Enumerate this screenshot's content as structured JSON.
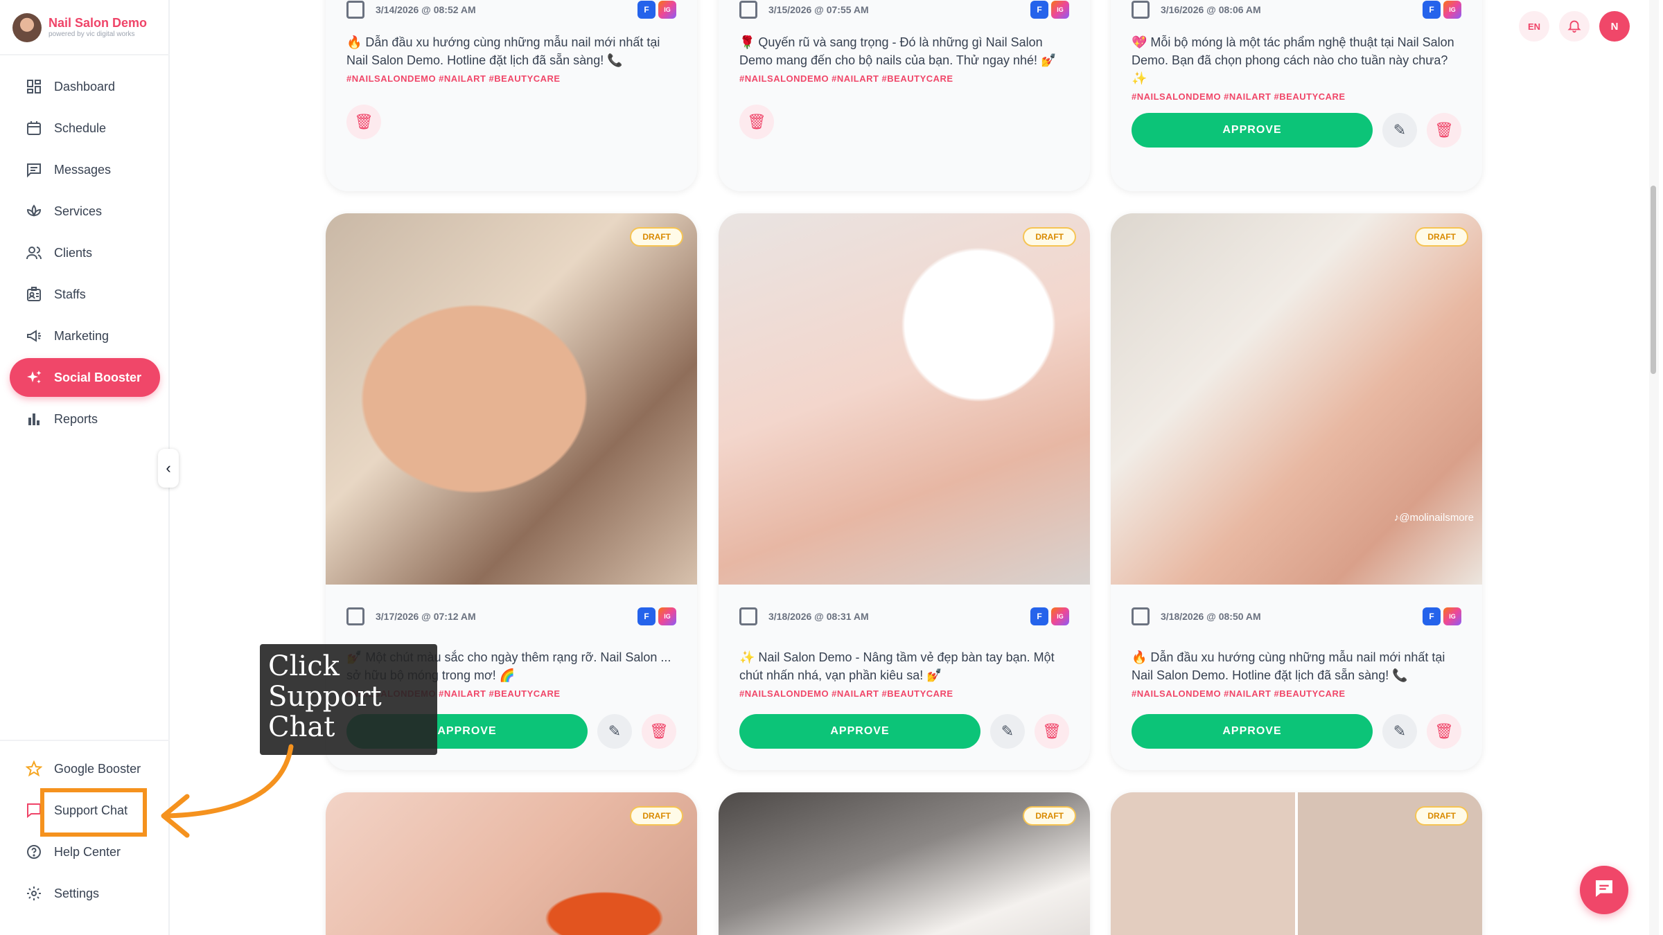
{
  "brand": {
    "name": "Nail Salon Demo",
    "subtitle": "powered by vic digital works"
  },
  "sidebar": {
    "items": [
      {
        "label": "Dashboard",
        "icon": "dashboard-icon"
      },
      {
        "label": "Schedule",
        "icon": "calendar-icon"
      },
      {
        "label": "Messages",
        "icon": "message-icon"
      },
      {
        "label": "Services",
        "icon": "lotus-icon"
      },
      {
        "label": "Clients",
        "icon": "users-icon"
      },
      {
        "label": "Staffs",
        "icon": "id-badge-icon"
      },
      {
        "label": "Marketing",
        "icon": "megaphone-icon"
      },
      {
        "label": "Social Booster",
        "icon": "sparkle-icon",
        "active": true
      },
      {
        "label": "Reports",
        "icon": "bar-chart-icon"
      }
    ],
    "bottom": [
      {
        "label": "Google Booster",
        "icon": "star-icon"
      },
      {
        "label": "Support Chat",
        "icon": "chat-icon"
      },
      {
        "label": "Help Center",
        "icon": "help-icon"
      },
      {
        "label": "Settings",
        "icon": "gear-icon"
      }
    ]
  },
  "topbar": {
    "lang": "EN",
    "avatar_initial": "N"
  },
  "tags": "#NAILSALONDEMO #NAILART #BEAUTYCARE",
  "draft_label": "DRAFT",
  "approve_label": "APPROVE",
  "platforms": {
    "fb": "F",
    "ig": "IG"
  },
  "posts_row1": [
    {
      "date": "3/14/2026 @ 08:52 AM",
      "caption": "🔥 Dẫn đầu xu hướng cùng những mẫu nail mới nhất tại Nail Salon Demo. Hotline đặt lịch đã sẵn sàng! 📞",
      "approvable": false
    },
    {
      "date": "3/15/2026 @ 07:55 AM",
      "caption": "🌹 Quyến rũ và sang trọng - Đó là những gì Nail Salon Demo mang đến cho bộ nails của bạn. Thử ngay nhé! 💅",
      "approvable": false
    },
    {
      "date": "3/16/2026 @ 08:06 AM",
      "caption": "💖 Mỗi bộ móng là một tác phẩm nghệ thuật tại Nail Salon Demo. Bạn đã chọn phong cách nào cho tuần này chưa? ✨",
      "approvable": true
    }
  ],
  "posts_row2": [
    {
      "date": "3/17/2026 @ 07:12 AM",
      "caption": "💅 Một chút màu sắc cho ngày thêm rạng rỡ. Nail Salon ... sở hữu bộ móng trong mơ! 🌈",
      "image": "nail-photo-swirl"
    },
    {
      "date": "3/18/2026 @ 08:31 AM",
      "caption": "✨ Nail Salon Demo - Nâng tầm vẻ đẹp bàn tay bạn. Một chút nhấn nhá, vạn phần kiêu sa! 💅",
      "image": "nail-photo-3d-flowers"
    },
    {
      "date": "3/18/2026 @ 08:50 AM",
      "caption": "🔥 Dẫn đầu xu hướng cùng những mẫu nail mới nhất tại Nail Salon Demo. Hotline đặt lịch đã sẵn sàng! 📞",
      "image": "nail-photo-french-star",
      "watermark": "♪@molinailsmore"
    }
  ],
  "tutorial": {
    "tooltip_text": "Click Support Chat"
  },
  "colors": {
    "brand": "#f04769",
    "approve": "#0cc478",
    "draft": "#f6c453"
  }
}
